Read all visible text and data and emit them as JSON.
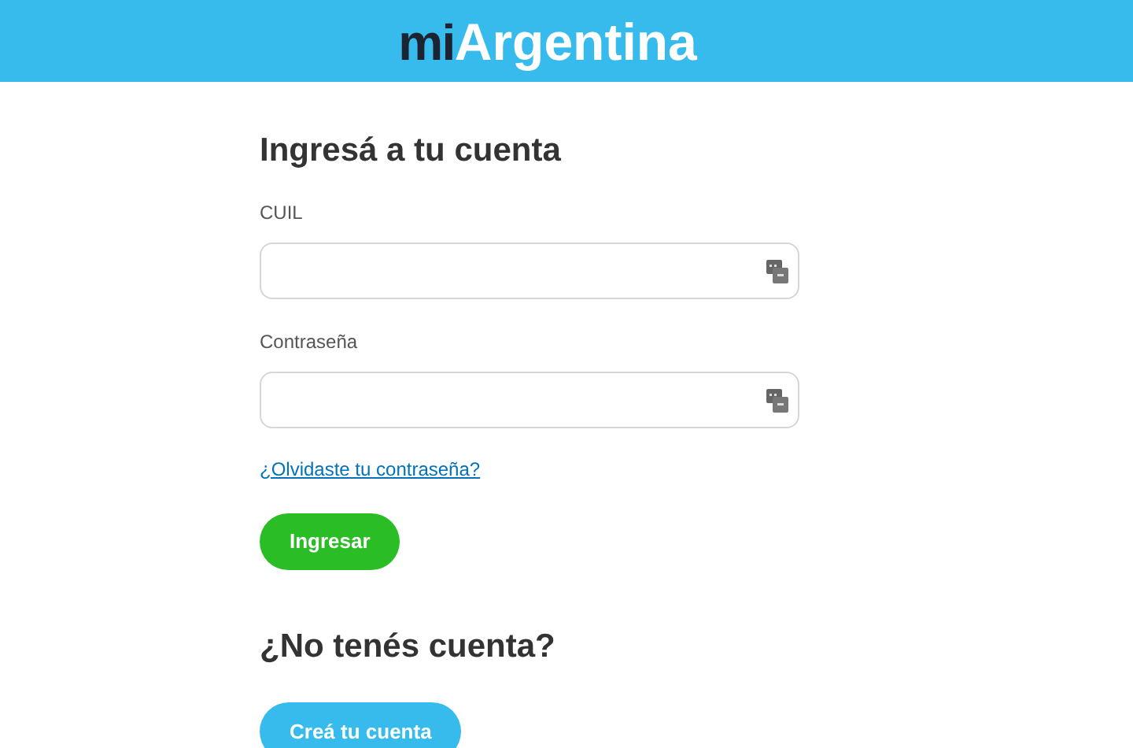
{
  "header": {
    "logo_prefix": "mi",
    "logo_main": "Argentina"
  },
  "login": {
    "title": "Ingresá a tu cuenta",
    "fields": [
      {
        "label": "CUIL"
      },
      {
        "label": "Contraseña"
      }
    ],
    "forgot_link": "¿Olvidaste tu contraseña?",
    "submit_button": "Ingresar"
  },
  "signup": {
    "title": "¿No tenés cuenta?",
    "button": "Creá tu cuenta"
  }
}
